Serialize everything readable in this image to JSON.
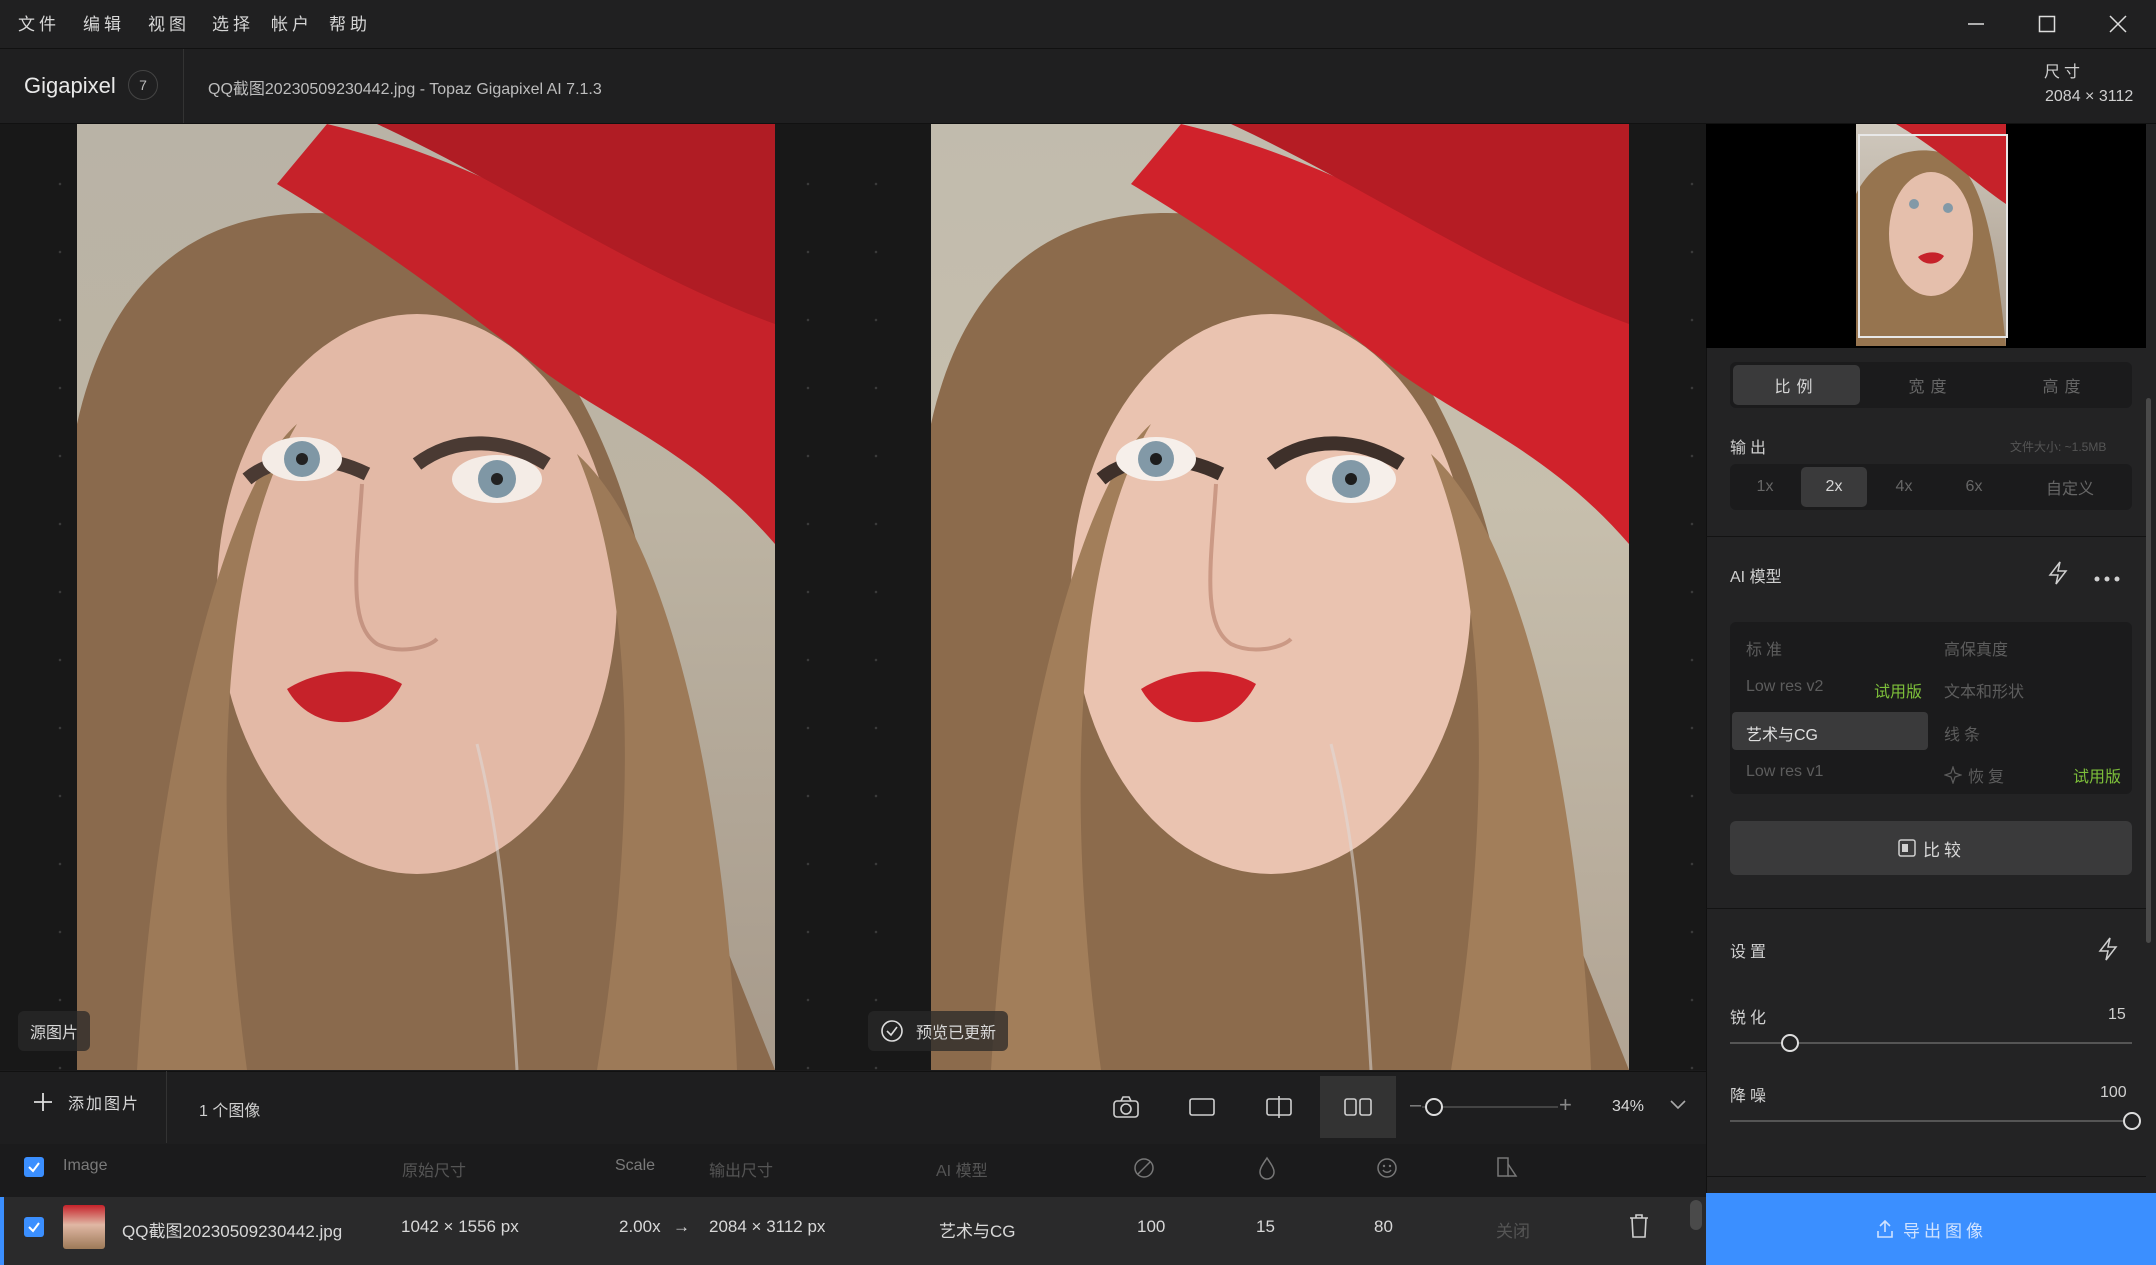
{
  "menu": [
    "文件",
    "编辑",
    "视图",
    "选择",
    "帐户",
    "帮助"
  ],
  "app": {
    "name": "Gigapixel",
    "badge": "7",
    "file_title": "QQ截图20230509230442.jpg - Topaz Gigapixel AI 7.1.3"
  },
  "dimensions": {
    "label": "尺寸",
    "value": "2084 × 3112"
  },
  "viewer": {
    "left_label": "源图片",
    "right_label": "预览已更新"
  },
  "toolbar": {
    "add_label": "添加图片",
    "count": "1 个图像",
    "zoom_level": "34%",
    "zoom_fraction": 0.09
  },
  "table": {
    "headers": {
      "image": "Image",
      "orig": "原始尺寸",
      "scale": "Scale",
      "output": "输出尺寸",
      "model": "AI 模型",
      "disabled": "关闭"
    },
    "row": {
      "name": "QQ截图20230509230442.jpg",
      "orig": "1042 × 1556 px",
      "scale": "2.00x",
      "arrow": "→",
      "output": "2084 × 3112 px",
      "model": "艺术与CG",
      "v1": "100",
      "v2": "15",
      "v3": "80",
      "v4": "关闭"
    }
  },
  "panel": {
    "size_tabs": [
      "比例",
      "宽度",
      "高度"
    ],
    "output_label": "输出",
    "file_size": "文件大小: ~1.5MB",
    "output_options": [
      "1x",
      "2x",
      "4x",
      "6x",
      "自定义"
    ],
    "ai_model_label": "AI 模型",
    "models": {
      "standard": "标准",
      "high_fidelity": "高保真度",
      "low_res_v2": "Low res v2",
      "trial1": "试用版",
      "text_shape": "文本和形状",
      "art_cg": "艺术与CG",
      "lines": "线条",
      "low_res_v1": "Low res v1",
      "recover": "恢复",
      "trial2": "试用版"
    },
    "compare_label": "比较",
    "settings_label": "设置",
    "sharpen_label": "锐化",
    "sharpen_value": "15",
    "sharpen_fraction": 0.15,
    "denoise_label": "降噪",
    "denoise_value": "100",
    "denoise_fraction": 1.0,
    "export_label": "导出图像"
  },
  "colors": {
    "accent": "#3b8fff",
    "trial": "#7dbf3a",
    "hat_red": "#c6222a"
  }
}
